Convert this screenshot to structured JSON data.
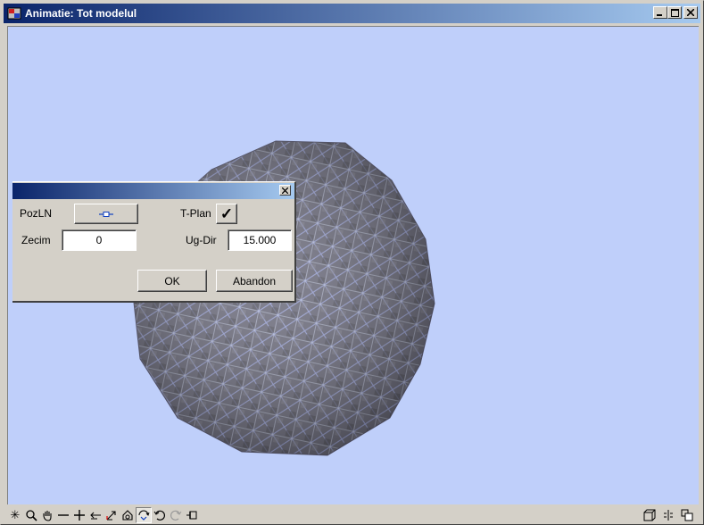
{
  "window": {
    "title": "Animatie: Tot modelul",
    "buttons": {
      "minimize": "_",
      "maximize": "□",
      "close": "×"
    }
  },
  "dialog": {
    "close_glyph": "×",
    "pozln_label": "PozLN",
    "pozln_icon": "line-node-icon",
    "tplan_label": "T-Plan",
    "tplan_check": "✓",
    "zecim_label": "Zecim",
    "zecim_value": "0",
    "ugdir_label": "Ug-Dir",
    "ugdir_value": "15.000",
    "ok_label": "OK",
    "abandon_label": "Abandon"
  },
  "colors": {
    "viewport_bg": "#bfcffa",
    "titlebar_start": "#0a246a",
    "titlebar_end": "#a6caf0",
    "mesh_fill": "#6f6f7a",
    "mesh_lines": "#a9b4f0"
  },
  "toolbar": {
    "left": [
      {
        "name": "asterisk-icon",
        "glyph": "✳"
      },
      {
        "name": "zoom-icon",
        "glyph": "🔍"
      },
      {
        "name": "pan-hand-icon",
        "glyph": "✋"
      },
      {
        "name": "zoom-out-icon",
        "glyph": "—"
      },
      {
        "name": "zoom-in-icon",
        "glyph": "+"
      },
      {
        "name": "arrow-left-icon",
        "glyph": "↤"
      },
      {
        "name": "axis-icon",
        "glyph": "↗"
      },
      {
        "name": "perspective-icon",
        "glyph": "⌂"
      },
      {
        "name": "rotate-icon",
        "glyph": "⟲"
      },
      {
        "name": "undo-icon",
        "glyph": "↶"
      },
      {
        "name": "redo-icon",
        "glyph": "↷"
      },
      {
        "name": "pin-icon",
        "glyph": "⊣"
      }
    ],
    "right": [
      {
        "name": "cube-icon",
        "glyph": "⧉"
      },
      {
        "name": "split-icon",
        "glyph": "⁞"
      },
      {
        "name": "copy-icon",
        "glyph": "⧈"
      }
    ]
  }
}
